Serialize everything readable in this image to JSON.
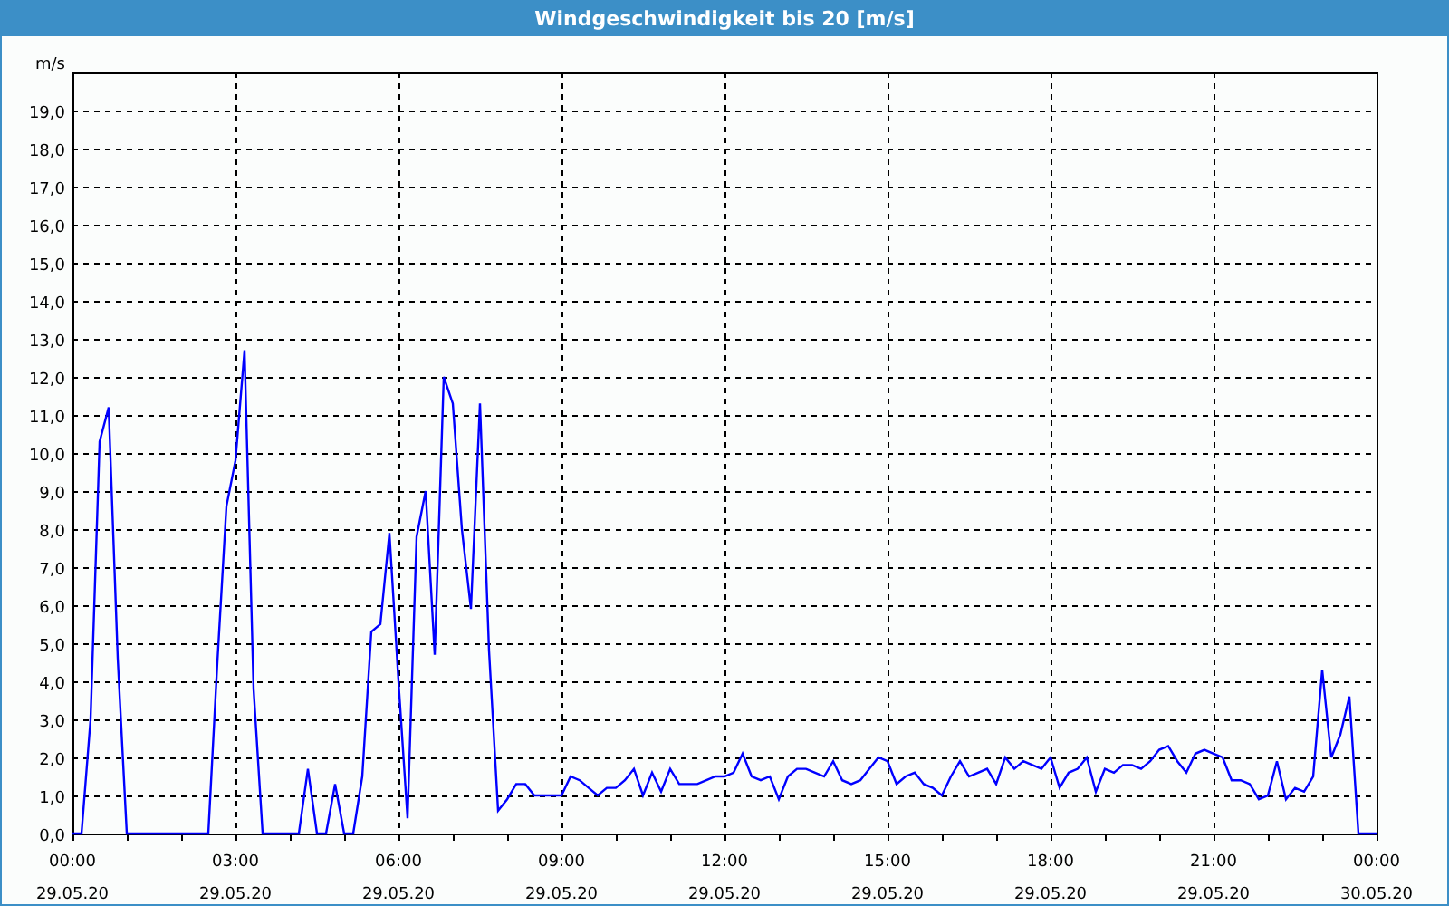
{
  "window": {
    "title": "Windgeschwindigkeit bis 20 [m/s]"
  },
  "chart": {
    "chart_data": {
      "type": "line",
      "ylabel": "m/s",
      "grid": true,
      "ylim": [
        0,
        20
      ],
      "categories": [
        "00:00\n29.05.20",
        null,
        null,
        null,
        null,
        null,
        null,
        null,
        null,
        null,
        null,
        null,
        null,
        null,
        null,
        null,
        null,
        null,
        "03:00\n29.05.20",
        null,
        null,
        null,
        null,
        null,
        null,
        null,
        null,
        null,
        null,
        null,
        null,
        null,
        null,
        null,
        null,
        null,
        "06:00\n29.05.20",
        null,
        null,
        null,
        null,
        null,
        null,
        null,
        null,
        null,
        null,
        null,
        null,
        null,
        null,
        null,
        null,
        null,
        "09:00\n29.05.20",
        null,
        null,
        null,
        null,
        null,
        null,
        null,
        null,
        null,
        null,
        null,
        null,
        null,
        null,
        null,
        null,
        null,
        "12:00\n29.05.20",
        null,
        null,
        null,
        null,
        null,
        null,
        null,
        null,
        null,
        null,
        null,
        null,
        null,
        null,
        null,
        null,
        null,
        "15:00\n29.05.20",
        null,
        null,
        null,
        null,
        null,
        null,
        null,
        null,
        null,
        null,
        null,
        null,
        null,
        null,
        null,
        null,
        null,
        "18:00\n29.05.20",
        null,
        null,
        null,
        null,
        null,
        null,
        null,
        null,
        null,
        null,
        null,
        null,
        null,
        null,
        null,
        null,
        null,
        "21:00\n29.05.20",
        null,
        null,
        null,
        null,
        null,
        null,
        null,
        null,
        null,
        null,
        null,
        null,
        null,
        null,
        null,
        null,
        null,
        "00:00\n30.05.20"
      ],
      "yticks": [
        {
          "value": 0,
          "label": "0,0"
        },
        {
          "value": 1,
          "label": "1,0"
        },
        {
          "value": 2,
          "label": "2,0"
        },
        {
          "value": 3,
          "label": "3,0"
        },
        {
          "value": 4,
          "label": "4,0"
        },
        {
          "value": 5,
          "label": "5,0"
        },
        {
          "value": 6,
          "label": "6,0"
        },
        {
          "value": 7,
          "label": "7,0"
        },
        {
          "value": 8,
          "label": "8,0"
        },
        {
          "value": 9,
          "label": "9,0"
        },
        {
          "value": 10,
          "label": "10,0"
        },
        {
          "value": 11,
          "label": "11,0"
        },
        {
          "value": 12,
          "label": "12,0"
        },
        {
          "value": 13,
          "label": "13,0"
        },
        {
          "value": 14,
          "label": "14,0"
        },
        {
          "value": 15,
          "label": "15,0"
        },
        {
          "value": 16,
          "label": "16,0"
        },
        {
          "value": 17,
          "label": "17,0"
        },
        {
          "value": 18,
          "label": "18,0"
        },
        {
          "value": 19,
          "label": "19,0"
        }
      ],
      "series": [
        {
          "color": "#0000ff",
          "values": [
            0,
            0,
            3.0,
            10.3,
            11.2,
            4.6,
            0,
            0,
            0,
            0,
            0,
            0,
            0,
            0,
            0,
            0,
            4.5,
            8.6,
            9.8,
            12.7,
            3.8,
            0,
            0,
            0,
            0,
            0,
            1.7,
            0,
            0,
            1.3,
            0,
            0,
            1.5,
            5.3,
            5.5,
            7.9,
            4.0,
            0.4,
            7.8,
            9.0,
            4.7,
            12.0,
            11.3,
            8.0,
            5.9,
            11.3,
            4.8,
            0.6,
            0.9,
            1.3,
            1.3,
            1.0,
            1.0,
            1.0,
            1.0,
            1.5,
            1.4,
            1.2,
            1.0,
            1.2,
            1.2,
            1.4,
            1.7,
            1.0,
            1.6,
            1.1,
            1.7,
            1.3,
            1.3,
            1.3,
            1.4,
            1.5,
            1.5,
            1.6,
            2.1,
            1.5,
            1.4,
            1.5,
            0.9,
            1.5,
            1.7,
            1.7,
            1.6,
            1.5,
            1.9,
            1.4,
            1.3,
            1.4,
            1.7,
            2.0,
            1.9,
            1.3,
            1.5,
            1.6,
            1.3,
            1.2,
            1.0,
            1.5,
            1.9,
            1.5,
            1.6,
            1.7,
            1.3,
            2.0,
            1.7,
            1.9,
            1.8,
            1.7,
            2.0,
            1.2,
            1.6,
            1.7,
            2.0,
            1.1,
            1.7,
            1.6,
            1.8,
            1.8,
            1.7,
            1.9,
            2.2,
            2.3,
            1.9,
            1.6,
            2.1,
            2.2,
            2.1,
            2.0,
            1.4,
            1.4,
            1.3,
            0.9,
            1.0,
            1.9,
            0.9,
            1.2,
            1.1,
            1.5,
            4.3,
            2.0,
            2.6,
            3.6,
            0,
            0,
            0
          ]
        }
      ]
    }
  }
}
